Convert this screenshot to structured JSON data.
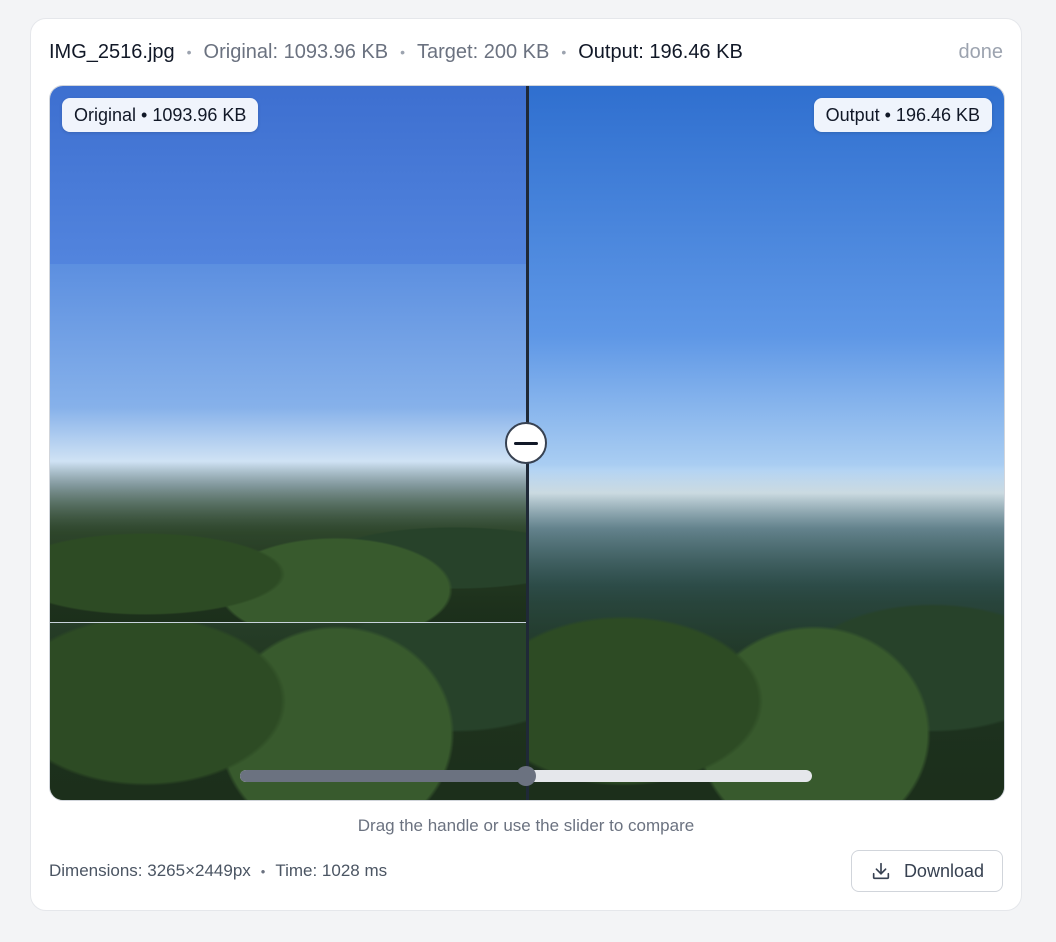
{
  "header": {
    "filename": "IMG_2516.jpg",
    "original": "Original: 1093.96 KB",
    "target": "Target: 200 KB",
    "output": "Output: 196.46 KB",
    "status": "done",
    "separator": "•"
  },
  "compare": {
    "left_badge": "Original • 1093.96 KB",
    "right_badge": "Output • 196.46 KB",
    "slider_value_percent": 50
  },
  "hint": "Drag the handle or use the slider to compare",
  "footer": {
    "dimensions": "Dimensions: 3265×2449px",
    "time": "Time: 1028 ms",
    "separator": "•",
    "download_label": "Download",
    "download_icon": "download-icon"
  }
}
